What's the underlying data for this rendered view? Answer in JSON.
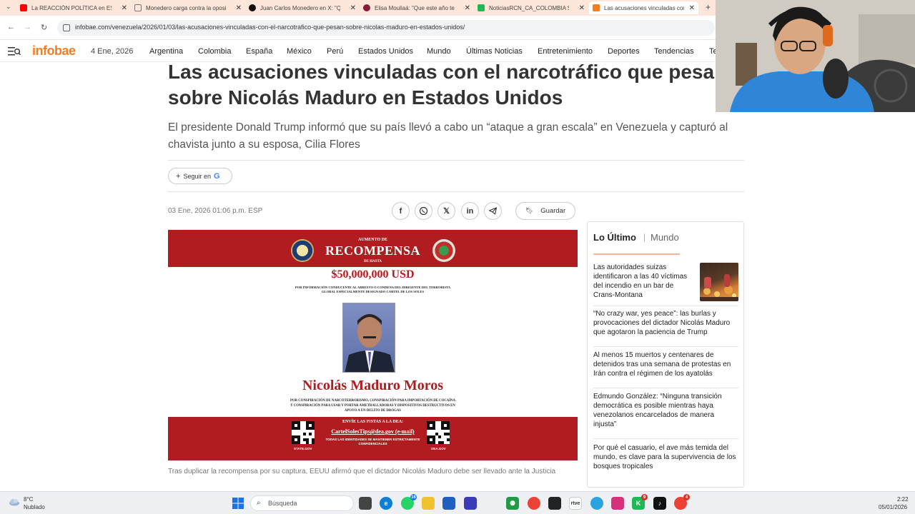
{
  "browser": {
    "tabs": [
      {
        "title": "La REACCIÓN POLÍTICA en ESPAÑA",
        "color": "#ff0000"
      },
      {
        "title": "Monedero carga contra la oposición",
        "color": "#888888"
      },
      {
        "title": "Juan Carlos Monedero en X: \"Q",
        "color": "#111111"
      },
      {
        "title": "Elisa Mouliaá: \"Que este año te",
        "color": "#8b1a3a"
      },
      {
        "title": "NoticiasRCN_CA_COLOMBIA S",
        "color": "#1db954"
      },
      {
        "title": "Las acusaciones vinculadas con",
        "color": "#f47d20"
      }
    ],
    "url": "infobae.com/venezuela/2026/01/03/las-acusaciones-vinculadas-con-el-narcotrafico-que-pesan-sobre-nicolas-maduro-en-estados-unidos/"
  },
  "site": {
    "logo": "infobae",
    "date": "4 Ene, 2026",
    "nav": [
      "Argentina",
      "Colombia",
      "España",
      "México",
      "Perú",
      "Estados Unidos",
      "Mundo",
      "Últimas Noticias",
      "Entretenimiento",
      "Deportes",
      "Tendencias",
      "Te"
    ],
    "brand_color": "#f47d20"
  },
  "article": {
    "headline_line1": "Las acusaciones vinculadas con el narcotráfico que pesan",
    "headline_line2": "sobre Nicolás Maduro en Estados Unidos",
    "subhead": "El presidente Donald Trump informó que su país llevó a cabo un “ataque a gran escala” en Venezuela y capturó al chavista junto a su esposa, Cilia Flores",
    "follow_label": "Seguir en",
    "follow_brand": "G",
    "pubdate": "03 Ene, 2026 01:06 p.m. ESP",
    "save_label": "Guardar",
    "share_icons": [
      "facebook-icon",
      "whatsapp-icon",
      "x-icon",
      "linkedin-icon",
      "telegram-icon"
    ],
    "caption": "Tras duplicar la recompensa por su captura, EEUU afirmó que el dictador Nicolás Maduro debe ser llevado ante la Justicia"
  },
  "poster": {
    "kicker": "AUMENTO DE",
    "title": "RECOMPENSA",
    "sub": "DE HASTA",
    "amount": "$50,000,000 USD",
    "info": "POR INFORMACIÓN CONDUCENTE AL ARRESTO O CONDENA DEL DIRIGENTE DEL TERRORISTA GLOBAL ESPECIALMENTE DESIGNADO CARTEL DE LOS SOLES",
    "name": "Nicolás Maduro Moros",
    "charges": "POR CONSPIRACIÓN DE NARCOTERRORISMO, CONSPIRACIÓN PARA IMPORTACIÓN DE COCAÍNA Y CONSPIRACIÓN PARA USAR Y PORTAR AMETRALLADORAS Y DISPOSITIVOS DESTRUCTIVOS EN APOYO A UN DELITO DE DROGAS",
    "send": "ENVÍE LAS PISTAS A LA DEA:",
    "email": "CartelSolesTips@dea.gov (e-mail)",
    "confidential": "TODAS LAS IDENTIDADES SE MANTIENEN ESTRICTAMENTE CONFIDENCIALES",
    "qr_left": "STATE.GOV",
    "qr_right": "DEA.GOV",
    "red": "#b01c20"
  },
  "sidebar": {
    "title": "Lo Último",
    "separator": "|",
    "section": "Mundo",
    "items": [
      "Las autoridades suizas identificaron a las 40 víctimas del incendio en un bar de Crans-Montana",
      "“No crazy war, yes peace”: las burlas y provocaciones del dictador Nicolás Maduro que agotaron la paciencia de Trump",
      "Al menos 15 muertos y centenares de detenidos tras una semana de protestas en Irán contra el régimen de los ayatolás",
      "Edmundo González: “Ninguna transición democrática es posible mientras haya venezolanos encarcelados de manera injusta”",
      "Por qué el casuario, el ave más temida del mundo, es clave para la supervivencia de los bosques tropicales"
    ]
  },
  "taskbar": {
    "temp": "8°C",
    "condition": "Nublado",
    "search_placeholder": "Búsqueda",
    "time": "2:22",
    "date": "05/01/2026",
    "badges": {
      "whatsapp": "16",
      "app9": "9",
      "chrome": "4"
    }
  }
}
